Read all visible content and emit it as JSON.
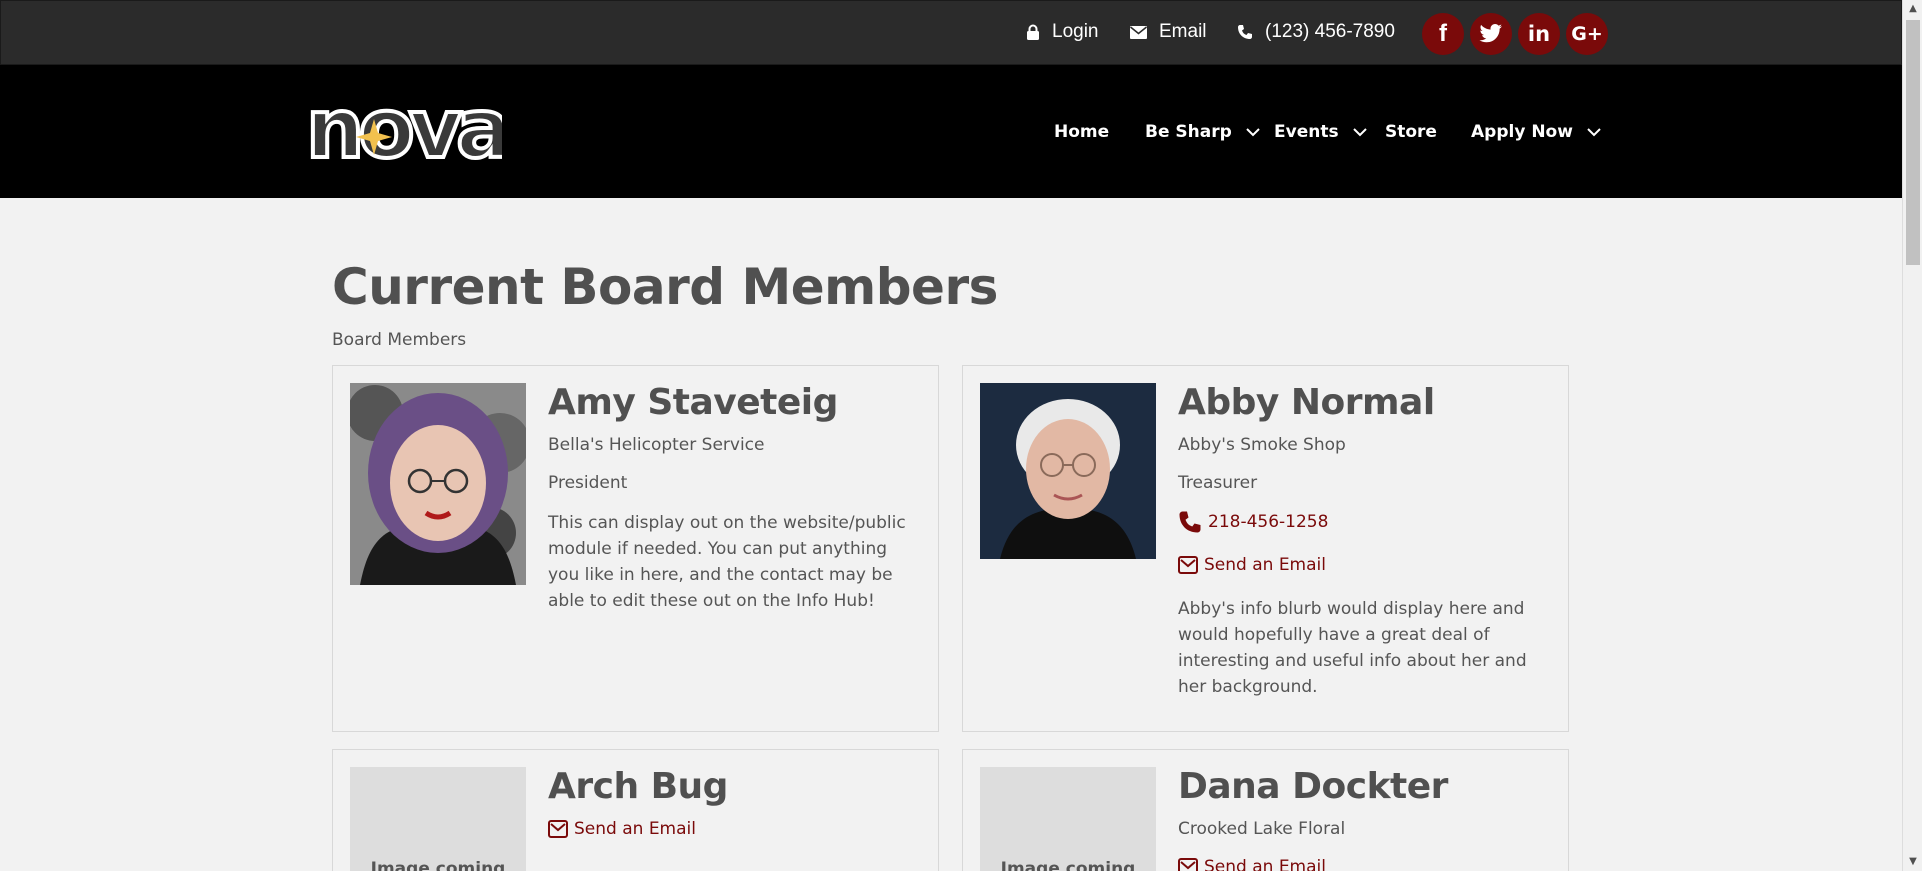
{
  "topbar": {
    "login_label": "Login",
    "email_label": "Email",
    "phone_label": "(123) 456-7890",
    "social": [
      {
        "icon": "facebook-icon",
        "glyph": "f"
      },
      {
        "icon": "twitter-icon",
        "glyph": ""
      },
      {
        "icon": "linkedin-icon",
        "glyph": "in"
      },
      {
        "icon": "google-plus-icon",
        "glyph": "G+"
      }
    ]
  },
  "nav": {
    "logo_text": "nova",
    "items": [
      {
        "label": "Home",
        "has_dropdown": false
      },
      {
        "label": "Be Sharp",
        "has_dropdown": true
      },
      {
        "label": "Events",
        "has_dropdown": true
      },
      {
        "label": "Store",
        "has_dropdown": false
      },
      {
        "label": "Apply Now",
        "has_dropdown": true
      }
    ]
  },
  "main": {
    "title": "Current Board Members",
    "subtitle": "Board Members",
    "members": [
      {
        "name": "Amy Staveteig",
        "company": "Bella's Helicopter Service",
        "role": "President",
        "bio": "This can display out on the website/public module if needed. You can put anything you like in here, and the contact may be able to edit these out on the Info Hub!"
      },
      {
        "name": "Abby Normal",
        "company": "Abby's Smoke Shop",
        "role": "Treasurer",
        "phone": "218-456-1258",
        "email_label": "Send an Email",
        "bio": "Abby's info blurb would display here and would hopefully have a great deal of interesting and useful info about her and her background."
      },
      {
        "name": "Arch Bug",
        "email_label": "Send an Email",
        "image_placeholder": "Image coming"
      },
      {
        "name": "Dana Dockter",
        "company": "Crooked Lake Floral",
        "email_label": "Send an Email",
        "image_placeholder": "Image coming"
      }
    ]
  },
  "colors": {
    "accent": "#7a0a0a",
    "topbar_bg": "#2b2b2b",
    "nav_bg": "#000000",
    "page_bg": "#f2f2f2",
    "heading": "#505050",
    "logo_star": "#f2c14e"
  }
}
